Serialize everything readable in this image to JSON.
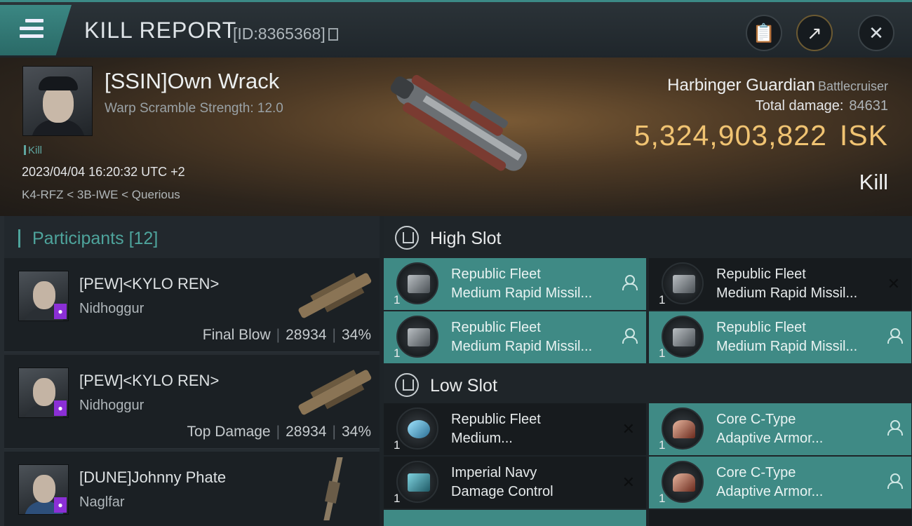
{
  "header": {
    "title": "KILL REPORT",
    "report_id": "[ID:8365368]",
    "icons": [
      "menu-icon",
      "clipboard-icon",
      "share-icon",
      "close-icon"
    ]
  },
  "victim": {
    "name": "[SSIN]Own Wrack",
    "warp_scramble": "Warp Scramble Strength: 12.0",
    "tag": "Kill",
    "datetime": "2023/04/04 16:20:32 UTC +2",
    "location": "K4-RFZ < 3B-IWE < Querious",
    "ship": "Harbinger Guardian",
    "ship_class": "Battlecruiser",
    "total_damage_label": "Total damage:",
    "total_damage_value": "84631",
    "isk_value": "5,324,903,822",
    "isk_unit": "ISK",
    "result": "Kill"
  },
  "participants": {
    "label": "Participants",
    "count": "[12]",
    "rows": [
      {
        "name": "[PEW]<KYLO REN>",
        "ship": "Nidhoggur",
        "stat_label": "Final Blow",
        "damage": "28934",
        "percent": "34%"
      },
      {
        "name": "[PEW]<KYLO REN>",
        "ship": "Nidhoggur",
        "stat_label": "Top Damage",
        "damage": "28934",
        "percent": "34%"
      },
      {
        "name": "[DUNE]Johnny Phate",
        "ship": "Naglfar",
        "stat_label": "",
        "damage": "",
        "percent": ""
      }
    ]
  },
  "fitting": {
    "high_slot_label": "High Slot",
    "low_slot_label": "Low Slot",
    "high": [
      {
        "l1": "Republic Fleet",
        "l2": "Medium Rapid Missil...",
        "qty": "1",
        "state": "fitted"
      },
      {
        "l1": "Republic Fleet",
        "l2": "Medium Rapid Missil...",
        "qty": "1",
        "state": "destroyed"
      },
      {
        "l1": "Republic Fleet",
        "l2": "Medium Rapid Missil...",
        "qty": "1",
        "state": "fitted"
      },
      {
        "l1": "Republic Fleet",
        "l2": "Medium Rapid Missil...",
        "qty": "1",
        "state": "fitted"
      }
    ],
    "low": [
      {
        "l1": "Republic Fleet",
        "l2": "Medium...",
        "qty": "1",
        "state": "destroyed"
      },
      {
        "l1": "Core C-Type",
        "l2": "Adaptive Armor...",
        "qty": "1",
        "state": "fitted"
      },
      {
        "l1": "Imperial Navy",
        "l2": "Damage Control",
        "qty": "1",
        "state": "destroyed"
      },
      {
        "l1": "Core C-Type",
        "l2": "Adaptive Armor...",
        "qty": "1",
        "state": "fitted"
      }
    ]
  },
  "colors": {
    "accent": "#3f8a85",
    "isk": "#f0c372",
    "participants": "#4ea49c"
  }
}
